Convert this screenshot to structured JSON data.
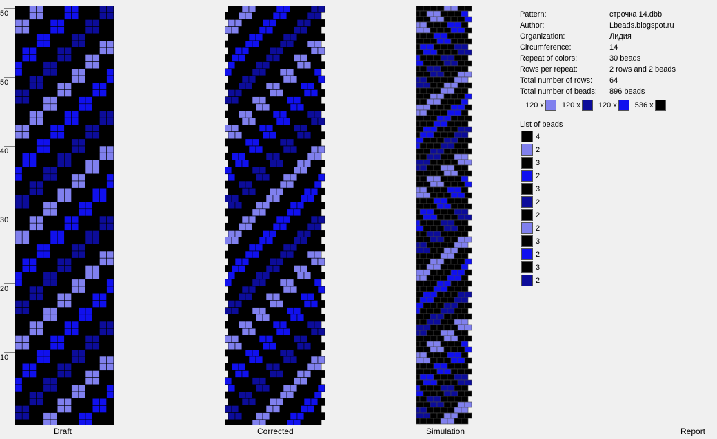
{
  "views": {
    "draft_label": "Draft",
    "corrected_label": "Corrected",
    "simulation_label": "Simulation",
    "report_label": "Report"
  },
  "ruler": [
    "50",
    "50",
    "40",
    "30",
    "20",
    "10"
  ],
  "colors": {
    "black": "#000000",
    "light": "#8080ee",
    "navy": "#0c0c9a",
    "blue": "#1010ee",
    "background": "#f0f0f0"
  },
  "report": {
    "rows": [
      {
        "key": "Pattern:",
        "value": "строчка 14.dbb"
      },
      {
        "key": "Author:",
        "value": "Lbeads.blogspot.ru"
      },
      {
        "key": "Organization:",
        "value": "Лидия"
      },
      {
        "key": "Circumference:",
        "value": "14"
      },
      {
        "key": "Repeat of colors:",
        "value": "30 beads"
      },
      {
        "key": "Rows per repeat:",
        "value": "2 rows and 2 beads"
      },
      {
        "key": "Total number of rows:",
        "value": "64"
      },
      {
        "key": "Total number of beads:",
        "value": "896 beads"
      }
    ],
    "color_counts": [
      {
        "count": "120 x",
        "color": "light"
      },
      {
        "count": "120 x",
        "color": "navy"
      },
      {
        "count": "120 x",
        "color": "blue"
      },
      {
        "count": "536 x",
        "color": "black"
      }
    ],
    "list_title": "List of beads",
    "list": [
      {
        "count": "4",
        "color": "black"
      },
      {
        "count": "2",
        "color": "light"
      },
      {
        "count": "3",
        "color": "black"
      },
      {
        "count": "2",
        "color": "blue"
      },
      {
        "count": "3",
        "color": "black"
      },
      {
        "count": "2",
        "color": "navy"
      },
      {
        "count": "2",
        "color": "black"
      },
      {
        "count": "2",
        "color": "light"
      },
      {
        "count": "3",
        "color": "black"
      },
      {
        "count": "2",
        "color": "blue"
      },
      {
        "count": "3",
        "color": "black"
      },
      {
        "count": "2",
        "color": "navy"
      }
    ]
  }
}
